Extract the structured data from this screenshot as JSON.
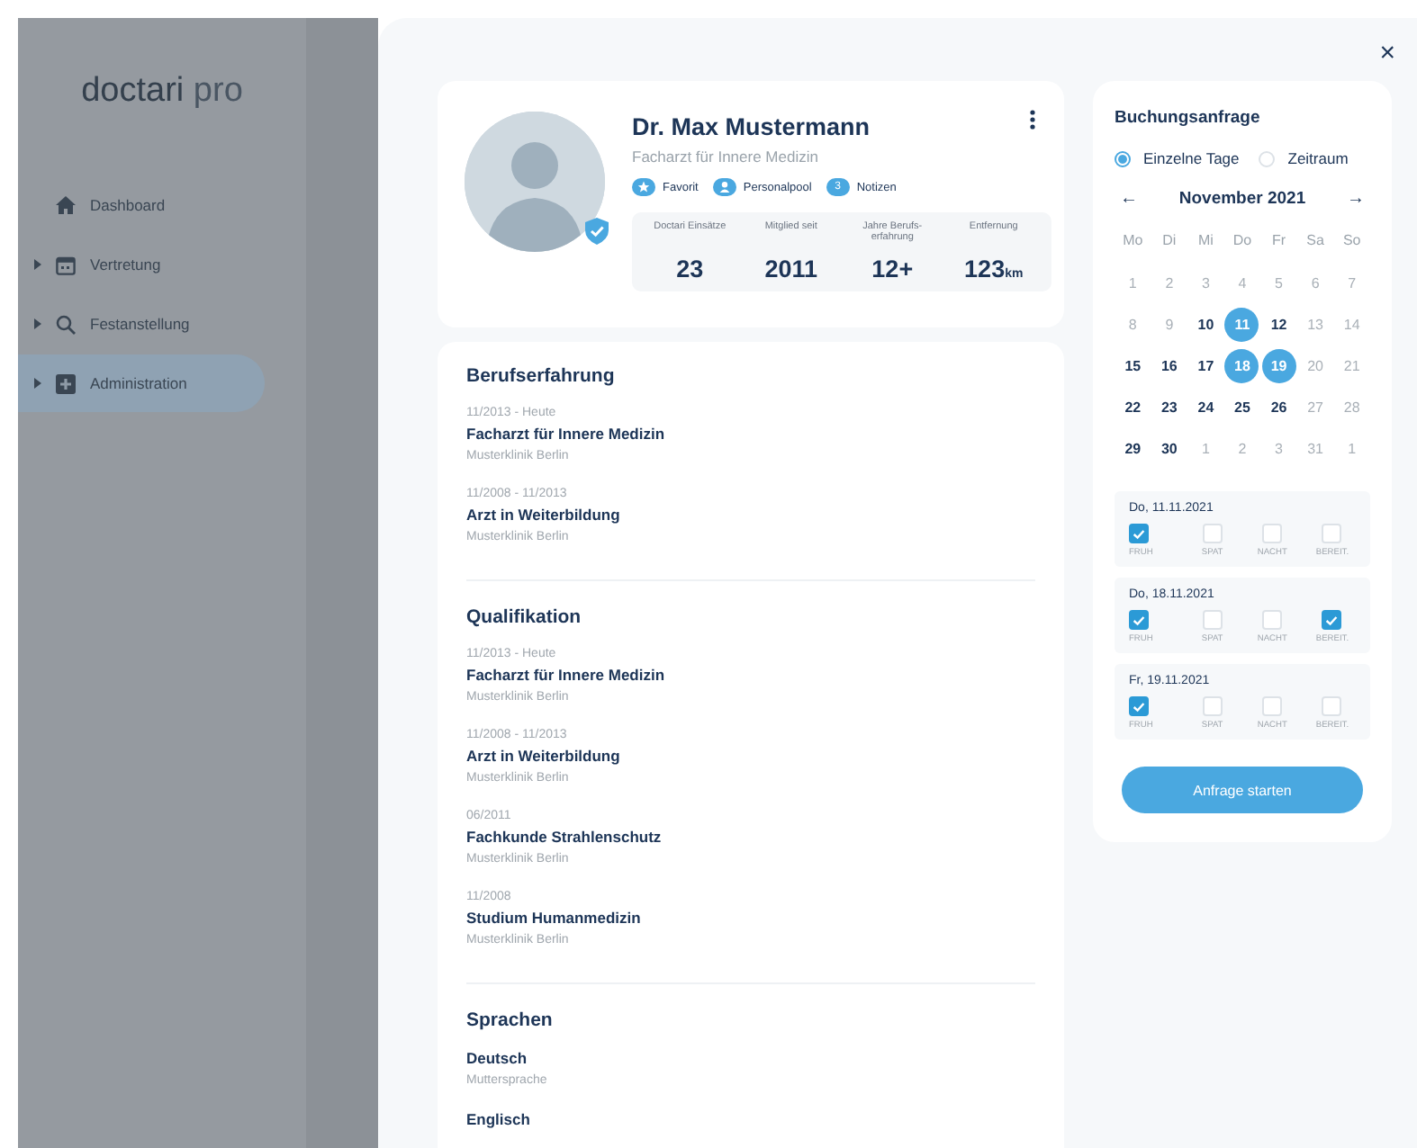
{
  "sidebar": {
    "logo": {
      "brand": "doctari",
      "suffix": "pro"
    },
    "items": [
      {
        "label": "Dashboard",
        "kind": "link",
        "selected": false
      },
      {
        "label": "Vertretung",
        "kind": "group",
        "selected": false
      },
      {
        "label": "Festanstellung",
        "kind": "group",
        "selected": false
      },
      {
        "label": "Administration",
        "kind": "group",
        "selected": true
      }
    ]
  },
  "dialog": {
    "close": "×"
  },
  "profile": {
    "name": "Dr. Max Mustermann",
    "subtitle": "Facharzt für Innere Medizin",
    "verified": true,
    "tags": [
      {
        "kind": "star",
        "label": "Favorit"
      },
      {
        "kind": "person",
        "label": "Personalpool"
      },
      {
        "kind": "count",
        "count": "3",
        "label": "Notizen"
      }
    ],
    "stats": [
      {
        "label": "Doctari Einsätze",
        "value": "23"
      },
      {
        "label": "Mitglied seit",
        "value": "2011"
      },
      {
        "label": "Jahre Berufs-erfahrung",
        "value": "12+"
      },
      {
        "label": "Entfernung",
        "value": "123",
        "unit": "km"
      }
    ]
  },
  "sections": [
    {
      "title": "Berufserfahrung",
      "entries": [
        {
          "date": "11/2013 - Heute",
          "title": "Facharzt für Innere Medizin",
          "place": "Musterklinik Berlin"
        },
        {
          "date": "11/2008 - 11/2013",
          "title": "Arzt in Weiterbildung",
          "place": "Musterklinik Berlin"
        }
      ]
    },
    {
      "title": "Qualifikation",
      "entries": [
        {
          "date": "11/2013 - Heute",
          "title": "Facharzt für Innere Medizin",
          "place": "Musterklinik Berlin"
        },
        {
          "date": "11/2008 - 11/2013",
          "title": "Arzt in Weiterbildung",
          "place": "Musterklinik Berlin"
        },
        {
          "date": "06/2011",
          "title": "Fachkunde Strahlenschutz",
          "place": "Musterklinik Berlin"
        },
        {
          "date": "11/2008",
          "title": "Studium Humanmedizin",
          "place": "Musterklinik Berlin"
        }
      ]
    },
    {
      "title": "Sprachen",
      "entries": [
        {
          "title": "Deutsch",
          "place": "Muttersprache"
        },
        {
          "title": "Englisch"
        }
      ]
    }
  ],
  "booking": {
    "title": "Buchungsanfrage",
    "modes": [
      {
        "label": "Einzelne Tage",
        "selected": true
      },
      {
        "label": "Zeitraum",
        "selected": false
      }
    ],
    "calendar": {
      "prev": "←",
      "month": "November 2021",
      "next": "→",
      "weekdays": [
        "Mo",
        "Di",
        "Mi",
        "Do",
        "Fr",
        "Sa",
        "So"
      ],
      "days": [
        {
          "label": "1",
          "muted": true,
          "selected": false
        },
        {
          "label": "2",
          "muted": true,
          "selected": false
        },
        {
          "label": "3",
          "muted": true,
          "selected": false
        },
        {
          "label": "4",
          "muted": true,
          "selected": false
        },
        {
          "label": "5",
          "muted": true,
          "selected": false
        },
        {
          "label": "6",
          "muted": true,
          "selected": false
        },
        {
          "label": "7",
          "muted": true,
          "selected": false
        },
        {
          "label": "8",
          "muted": true,
          "selected": false
        },
        {
          "label": "9",
          "muted": true,
          "selected": false
        },
        {
          "label": "10",
          "muted": false,
          "selected": false
        },
        {
          "label": "11",
          "muted": false,
          "selected": true
        },
        {
          "label": "12",
          "muted": false,
          "selected": false
        },
        {
          "label": "13",
          "muted": true,
          "selected": false
        },
        {
          "label": "14",
          "muted": true,
          "selected": false
        },
        {
          "label": "15",
          "muted": false,
          "selected": false
        },
        {
          "label": "16",
          "muted": false,
          "selected": false
        },
        {
          "label": "17",
          "muted": false,
          "selected": false
        },
        {
          "label": "18",
          "muted": false,
          "selected": true
        },
        {
          "label": "19",
          "muted": false,
          "selected": true
        },
        {
          "label": "20",
          "muted": true,
          "selected": false
        },
        {
          "label": "21",
          "muted": true,
          "selected": false
        },
        {
          "label": "22",
          "muted": false,
          "selected": false
        },
        {
          "label": "23",
          "muted": false,
          "selected": false
        },
        {
          "label": "24",
          "muted": false,
          "selected": false
        },
        {
          "label": "25",
          "muted": false,
          "selected": false
        },
        {
          "label": "26",
          "muted": false,
          "selected": false
        },
        {
          "label": "27",
          "muted": true,
          "selected": false
        },
        {
          "label": "28",
          "muted": true,
          "selected": false
        },
        {
          "label": "29",
          "muted": false,
          "selected": false
        },
        {
          "label": "30",
          "muted": false,
          "selected": false
        },
        {
          "label": "1",
          "muted": true,
          "selected": false
        },
        {
          "label": "2",
          "muted": true,
          "selected": false
        },
        {
          "label": "3",
          "muted": true,
          "selected": false
        },
        {
          "label": "31",
          "muted": true,
          "selected": false
        },
        {
          "label": "1",
          "muted": true,
          "selected": false
        }
      ]
    },
    "dates": [
      {
        "date": "Do, 11.11.2021",
        "shifts": [
          {
            "label": "FRUH",
            "checked": true
          },
          {
            "label": "SPAT",
            "checked": false
          },
          {
            "label": "NACHT",
            "checked": false
          },
          {
            "label": "BEREIT.",
            "checked": false
          }
        ]
      },
      {
        "date": "Do, 18.11.2021",
        "shifts": [
          {
            "label": "FRUH",
            "checked": true
          },
          {
            "label": "SPAT",
            "checked": false
          },
          {
            "label": "NACHT",
            "checked": false
          },
          {
            "label": "BEREIT.",
            "checked": true
          }
        ]
      },
      {
        "date": "Fr, 19.11.2021",
        "shifts": [
          {
            "label": "FRUH",
            "checked": true
          },
          {
            "label": "SPAT",
            "checked": false
          },
          {
            "label": "NACHT",
            "checked": false
          },
          {
            "label": "BEREIT.",
            "checked": false
          }
        ]
      }
    ],
    "submit": "Anfrage starten"
  }
}
